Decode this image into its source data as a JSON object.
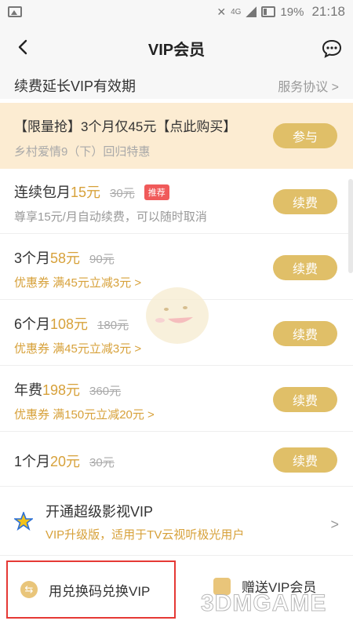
{
  "statusbar": {
    "network": "4G",
    "battery": "19%",
    "time": "21:18"
  },
  "header": {
    "title": "VIP会员",
    "back_icon": "back-chevron-icon",
    "message_icon": "chat-bubble-icon"
  },
  "renew": {
    "label": "续费延长VIP有效期",
    "agreement": "服务协议 >"
  },
  "promo": {
    "title": "【限量抢】3个月仅45元【点此购买】",
    "subtitle": "乡村爱情9（下）回归特惠",
    "button": "参与"
  },
  "plans": [
    {
      "name": "连续包月",
      "price": "15元",
      "original": "30元",
      "tag": "推荐",
      "note": "尊享15元/月自动续费，可以随时取消",
      "button": "续费"
    },
    {
      "name": "3个月",
      "price": "58元",
      "original": "90元",
      "note": "优惠券 满45元立减3元 >",
      "button": "续费"
    },
    {
      "name": "6个月",
      "price": "108元",
      "original": "180元",
      "note": "优惠券 满45元立减3元 >",
      "button": "续费"
    },
    {
      "name": "年费",
      "price": "198元",
      "original": "360元",
      "note": "优惠券 满150元立减20元 >",
      "button": "续费"
    },
    {
      "name": "1个月",
      "price": "20元",
      "original": "30元",
      "button": "续费"
    }
  ],
  "svip": {
    "title": "开通超级影视VIP",
    "subtitle": "VIP升级版，适用于TV云视听极光用户",
    "chevron": ">"
  },
  "bottom": {
    "redeem": "用兑换码兑换VIP",
    "gift": "赠送VIP会员"
  },
  "watermark": "3DMGAME",
  "colors": {
    "accent": "#e0bf68",
    "gold_text": "#d7a13a",
    "promo_bg": "#fcecd2",
    "tag_red": "#f05a5a",
    "highlight_border": "#e53935"
  }
}
